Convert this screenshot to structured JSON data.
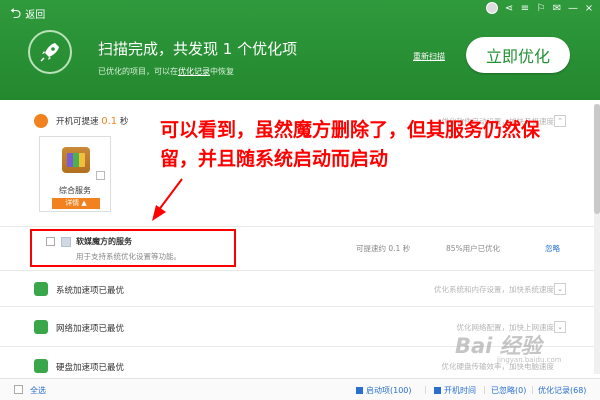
{
  "window": {
    "back_label": "返回",
    "controls": [
      "≡",
      "⚐",
      "✉",
      "—",
      "×"
    ]
  },
  "header": {
    "title": "扫描完成，共发现 1 个优化项",
    "subtitle_prefix": "已优化的项目，可以在",
    "subtitle_link": "优化记录",
    "subtitle_suffix": "中恢复",
    "rescan": "重新扫描",
    "optimize_button": "立即优化",
    "accent_color": "#24882f"
  },
  "boot_section": {
    "label": "开机可提速",
    "value": "0.1",
    "unit": "秒",
    "right_text": "优化软件启动设置，加快开机速度",
    "card": {
      "label": "综合服务",
      "detail": "详情 ▲"
    }
  },
  "annotation": {
    "text": "可以看到，虽然魔方删除了，但其服务仍然保留，并且随系统启动而启动",
    "color": "#ff0000"
  },
  "service_item": {
    "name": "软媒魔方的服务",
    "description": "用于支持系统优化设置等功能。",
    "speed": "可提速约 0.1 秒",
    "percent": "85%用户已优化",
    "ignore": "忽略"
  },
  "categories": [
    {
      "label": "系统加速项已最优",
      "right": "优化系统和内存设置，加快系统速度",
      "icon": "windows-icon"
    },
    {
      "label": "网络加速项已最优",
      "right": "优化网络配置，加快上网速度",
      "icon": "network-icon"
    },
    {
      "label": "硬盘加速项已最优",
      "right": "优化硬盘传输效率，加快电脑速度",
      "icon": "disk-icon"
    }
  ],
  "footer": {
    "select_all": "全选",
    "items": [
      {
        "label": "启动项(100)",
        "icon": "startup-icon"
      },
      {
        "label": "开机时间",
        "icon": "clock-icon"
      },
      {
        "label": "已忽略(0)",
        "icon": ""
      },
      {
        "label": "优化记录(68)",
        "icon": ""
      }
    ]
  },
  "watermark": {
    "text": "Bai 经验",
    "sub": "jingyan.baidu.com"
  }
}
